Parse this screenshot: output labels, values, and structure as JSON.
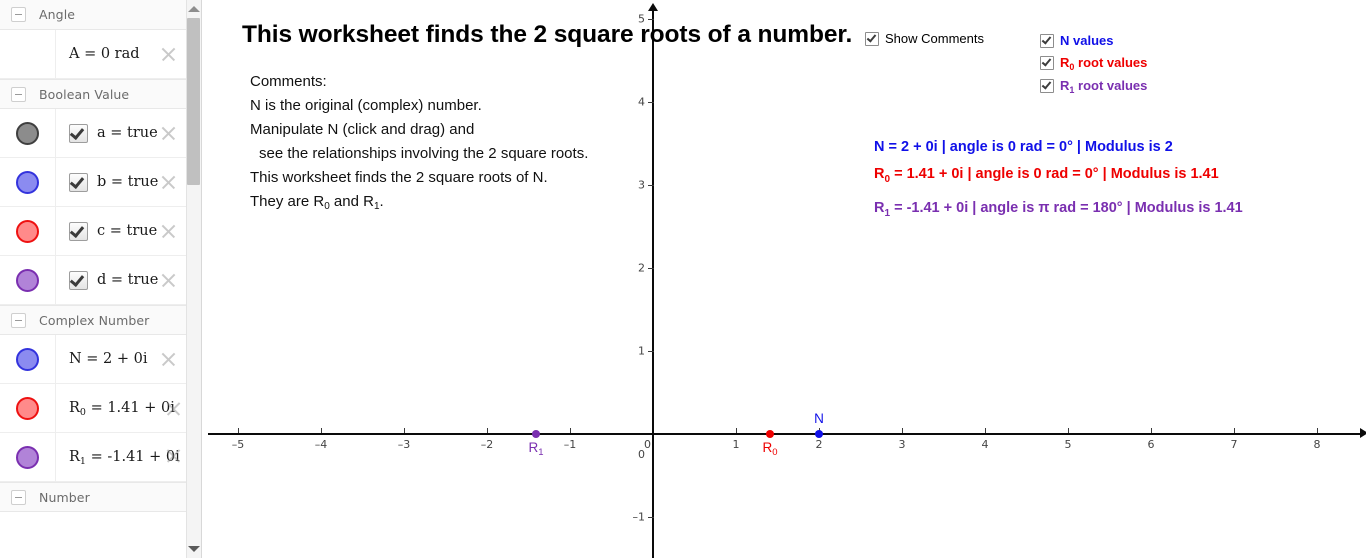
{
  "sidebar": {
    "sections": [
      {
        "title": "Angle",
        "collapse_icon": "minus-icon",
        "rows": [
          {
            "kind": "plain",
            "label": "A = 0 rad",
            "close_icon": "close-icon"
          }
        ]
      },
      {
        "title": "Boolean Value",
        "collapse_icon": "minus-icon",
        "rows": [
          {
            "kind": "bool",
            "label": "a = true",
            "checked": true,
            "dot_fill": "#8c8c8c",
            "dot_border": "#3f3f3f",
            "close_icon": "close-icon"
          },
          {
            "kind": "bool",
            "label": "b = true",
            "checked": true,
            "dot_fill": "#8b8bf0",
            "dot_border": "#3333dd",
            "close_icon": "close-icon"
          },
          {
            "kind": "bool",
            "label": "c = true",
            "checked": true,
            "dot_fill": "#ff8a8a",
            "dot_border": "#ee1111",
            "close_icon": "close-icon"
          },
          {
            "kind": "bool",
            "label": "d = true",
            "checked": true,
            "dot_fill": "#b183d8",
            "dot_border": "#7a2fb0",
            "close_icon": "close-icon"
          }
        ]
      },
      {
        "title": "Complex Number",
        "collapse_icon": "minus-icon",
        "rows": [
          {
            "kind": "value",
            "label": "N = 2 + 0i",
            "sub": "",
            "dot_fill": "#8b8bf0",
            "dot_border": "#3333dd",
            "close_icon": "close-icon"
          },
          {
            "kind": "value",
            "label": "R",
            "sub": "0",
            "tail": " = 1.41 + 0i",
            "dot_fill": "#ff8a8a",
            "dot_border": "#ee1111",
            "close_icon": "close-icon"
          },
          {
            "kind": "value",
            "label": "R",
            "sub": "1",
            "tail": " = -1.41 + 0i",
            "dot_fill": "#b183d8",
            "dot_border": "#7a2fb0",
            "close_icon": "close-icon"
          }
        ]
      },
      {
        "title": "Number",
        "collapse_icon": "minus-icon",
        "rows": []
      }
    ],
    "scrollbar": {
      "up_arrow": "scroll-up-icon",
      "down_arrow": "scroll-down-icon"
    }
  },
  "graph": {
    "title": "This worksheet finds the 2 square roots of a number.",
    "comments": [
      "Comments:",
      "N is the original (complex) number.",
      "Manipulate N (click and drag) and",
      "  see the relationships involving the 2 square roots.",
      "This worksheet finds the 2 square roots of N.",
      "They are R|0 and R|1."
    ],
    "checkboxes": [
      {
        "label": "Show Comments",
        "checked": true,
        "color": "#000000",
        "sub": ""
      },
      {
        "label": "N values",
        "checked": true,
        "color": "#1010e8",
        "sub": ""
      },
      {
        "label": "R",
        "sub": "0",
        "tail": " root values",
        "checked": true,
        "color": "#ee0000"
      },
      {
        "label": "R",
        "sub": "1",
        "tail": " root values",
        "checked": true,
        "color": "#7a2fb0"
      }
    ],
    "values": [
      {
        "head": "N",
        "sub": "",
        "tail": " = 2 + 0i  | angle is 0 rad = 0°  | Modulus is 2",
        "color": "#1010e8"
      },
      {
        "head": "R",
        "sub": "0",
        "tail": " = 1.41 + 0i  | angle is 0 rad =  0°  | Modulus is 1.41",
        "color": "#ee0000"
      },
      {
        "head": "R",
        "sub": "1",
        "tail": " = -1.41 + 0i  | angle is π rad =  180°  | Modulus is 1.41",
        "color": "#7a2fb0"
      }
    ]
  },
  "chart_data": {
    "type": "scatter",
    "title": "This worksheet finds the 2 square roots of a number.",
    "xlabel": "",
    "ylabel": "",
    "xlim": [
      -5.45,
      8.55
    ],
    "ylim": [
      -1.45,
      5.1
    ],
    "grid": false,
    "legend": "none",
    "xticks": [
      -5,
      -4,
      -3,
      -2,
      -1,
      0,
      1,
      2,
      3,
      4,
      5,
      6,
      7,
      8
    ],
    "yticks": [
      -1,
      0,
      1,
      2,
      3,
      4,
      5
    ],
    "points": [
      {
        "name": "R1",
        "label": "R",
        "sub": "1",
        "x": -1.41,
        "y": 0,
        "color": "#7a2fb0",
        "label_pos": "below"
      },
      {
        "name": "R0",
        "label": "R",
        "sub": "0",
        "x": 1.41,
        "y": 0,
        "color": "#ee0000",
        "label_pos": "below"
      },
      {
        "name": "N",
        "label": "N",
        "sub": "",
        "x": 2,
        "y": 0,
        "color": "#1010e8",
        "label_pos": "above"
      }
    ]
  }
}
